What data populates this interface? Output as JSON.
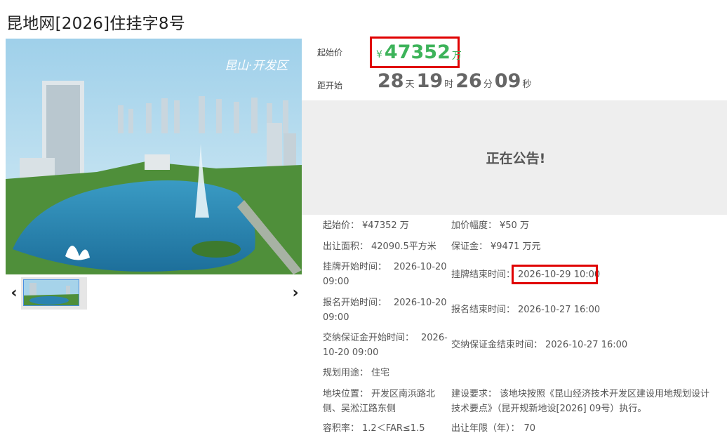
{
  "page": {
    "title": "昆地网[2026]住挂字8号"
  },
  "gallery": {
    "image_caption": "昆山·开发区",
    "prev_label": "‹",
    "next_label": "›"
  },
  "pricing": {
    "start_price_label": "起始价",
    "currency_symbol": "¥",
    "start_price_value": "47352",
    "start_price_unit": "万",
    "accent_color": "#3db35a",
    "highlight_color": "#e00000"
  },
  "countdown": {
    "label": "距开始",
    "days": "28",
    "days_unit": "天",
    "hours": "19",
    "hours_unit": "时",
    "minutes": "26",
    "minutes_unit": "分",
    "seconds": "09",
    "seconds_unit": "秒"
  },
  "status": {
    "notice": "正在公告!"
  },
  "details": {
    "start_price": {
      "label": "起始价：",
      "value": "¥47352 万"
    },
    "increment": {
      "label": "加价幅度：",
      "value": "¥50 万"
    },
    "area": {
      "label": "出让面积：",
      "value": "42090.5平方米"
    },
    "deposit": {
      "label": "保证金：",
      "value": "¥9471 万元"
    },
    "listing_start": {
      "label": "挂牌开始时间：",
      "value_line1": "2026-10-20",
      "value_line2": "09:00"
    },
    "listing_end": {
      "label": "挂牌结束时间：",
      "value": "2026-10-29 10:00"
    },
    "signup_start": {
      "label": "报名开始时间：",
      "value_line1": "2026-10-20",
      "value_line2": "09:00"
    },
    "signup_end": {
      "label": "报名结束时间：",
      "value": "2026-10-27 16:00"
    },
    "deposit_start": {
      "label": "交纳保证金开始时间：",
      "value_line1": "2026-",
      "value_line2": "10-20 09:00"
    },
    "deposit_end": {
      "label": "交纳保证金结束时间：",
      "value": "2026-10-27 16:00"
    },
    "usage": {
      "label": "规划用途：",
      "value": "住宅"
    },
    "location": {
      "label": "地块位置：",
      "value_line1": "开发区南浜路北",
      "value_line2": "侧、吴淞江路东侧"
    },
    "requirement": {
      "label": "建设要求：",
      "value_line1": "该地块按照《昆山经济技术开发区建设用地规划设计",
      "value_line2": "技术要点》（昆开规新地设[2026] 09号）执行。"
    },
    "far": {
      "label": "容积率：",
      "value": "1.2＜FAR≤1.5"
    },
    "term": {
      "label": "出让年限（年）：",
      "value": "70"
    }
  }
}
